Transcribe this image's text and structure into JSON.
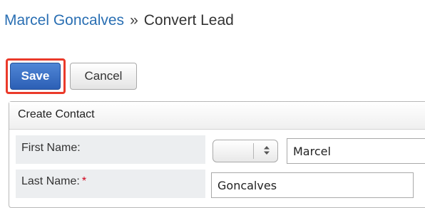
{
  "breadcrumb": {
    "record_name": "Marcel Goncalves",
    "separator": "»",
    "page": "Convert Lead"
  },
  "toolbar": {
    "save_label": "Save",
    "cancel_label": "Cancel"
  },
  "panel": {
    "title": "Create Contact",
    "fields": {
      "first_name": {
        "label": "First Name:",
        "salutation_value": "",
        "value": "Marcel"
      },
      "last_name": {
        "label": "Last Name:",
        "required_marker": "*",
        "value": "Goncalves"
      }
    }
  },
  "colors": {
    "link": "#2a6fb3",
    "save_button": "#3a6fc4",
    "highlight": "#ea3a2a",
    "required": "#d0021b",
    "label_background": "#eceef0"
  },
  "icons": {
    "select_arrows": "up-down-chevron-icon"
  }
}
